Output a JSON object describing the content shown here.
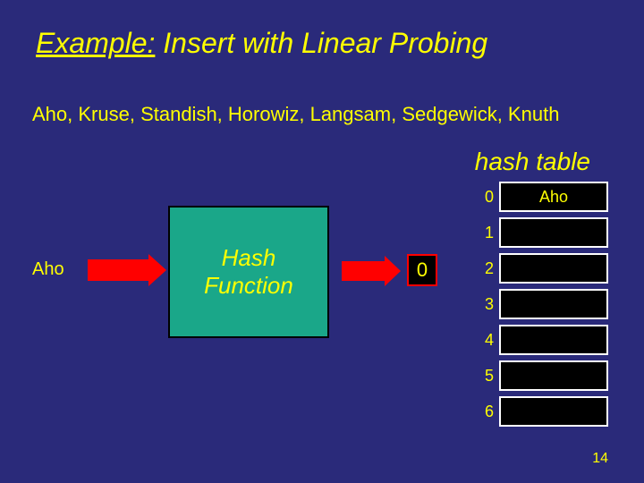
{
  "title": {
    "example": "Example:",
    "rest": " Insert with Linear Probing"
  },
  "names": "Aho, Kruse, Standish, Horowiz, Langsam, Sedgewick, Knuth",
  "hash_table_label": "hash table",
  "input_name": "Aho",
  "hash_box": "Hash\nFunction",
  "hash_output": "0",
  "table": {
    "indices": [
      "0",
      "1",
      "2",
      "3",
      "4",
      "5",
      "6"
    ],
    "values": [
      "Aho",
      "",
      "",
      "",
      "",
      "",
      ""
    ]
  },
  "page_number": "14"
}
